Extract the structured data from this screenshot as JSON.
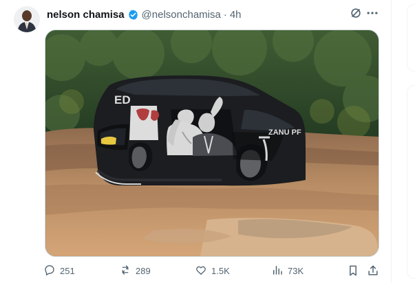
{
  "post": {
    "author_name": "nelson chamisa",
    "handle": "@nelsonchamisa",
    "separator": "·",
    "time": "4h",
    "media": {
      "vehicle_text_rear": "ED",
      "vehicle_text_side": "ZANU PF"
    },
    "actions": {
      "replies": "251",
      "reposts": "289",
      "likes": "1.5K",
      "views": "73K"
    }
  },
  "colors": {
    "text": "#0f1419",
    "muted": "#536471",
    "verified": "#1d9bf0",
    "border": "#cfd9de"
  },
  "icons": [
    "avatar",
    "verified-badge-icon",
    "grok-icon",
    "more-icon",
    "reply-icon",
    "repost-icon",
    "like-icon",
    "views-icon",
    "bookmark-icon",
    "share-icon"
  ]
}
